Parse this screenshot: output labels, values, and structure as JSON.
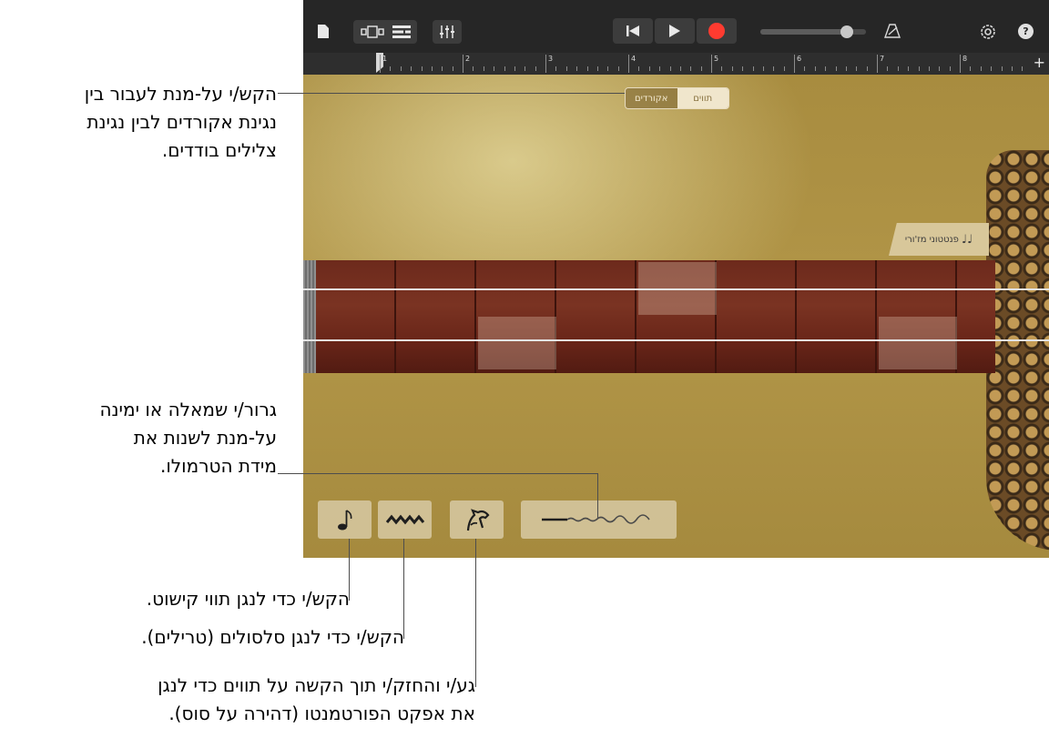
{
  "toolbar": {
    "icons": [
      "document-icon",
      "view-toggle-icon",
      "tracks-icon",
      "mixer-icon",
      "rewind-icon",
      "play-icon",
      "record-icon",
      "metronome-icon",
      "settings-icon",
      "help-icon"
    ],
    "record_color": "#ff3b30",
    "help_label": "?",
    "volume": 0.82
  },
  "ruler": {
    "bars": [
      "1",
      "2",
      "3",
      "4",
      "5",
      "6",
      "7",
      "8"
    ],
    "add_label": "+"
  },
  "mode_switch": {
    "selected": "תווים",
    "other": "אקורדים"
  },
  "chord_strip": {
    "label": "פנטטוני מז'ורי",
    "icon_glyph": "♩♩"
  },
  "controls": {
    "staccato_glyph": "♪",
    "trill_glyph": "∿∿∿",
    "portamento_glyph": "🐎",
    "tremolo_glyph": "—∿∿∿∿"
  },
  "callouts": {
    "mode_switch": [
      "הקש/י על-מנת לעבור בין",
      "נגינת אקורדים לבין נגינת",
      "צלילים בודדים."
    ],
    "tremolo": [
      "גרור/י שמאלה או ימינה",
      "על-מנת לשנות את",
      "מידת הטרמולו."
    ],
    "staccato": "הקש/י כדי לנגן תווי קישוט.",
    "trill": "הקש/י כדי לנגן סלסולים (טרילים).",
    "portamento": [
      "גע/י והחזק/י תוך הקשה על תווים כדי לנגן",
      "את אפקט הפורטמנטו (דהירה על סוס)."
    ]
  },
  "colors": {
    "stage": "#b29648",
    "neck": "#6d2a1c",
    "button": "#ded2b2"
  }
}
